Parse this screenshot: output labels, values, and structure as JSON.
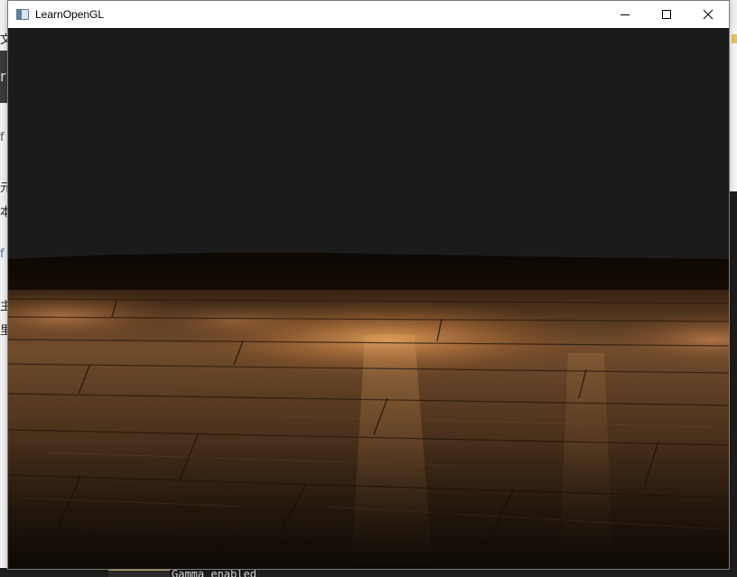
{
  "window": {
    "title": "LearnOpenGL",
    "controls": {
      "minimize": "minimize-icon",
      "maximize": "maximize-icon",
      "close": "close-icon"
    }
  },
  "scene": {
    "description_colors": {
      "sky": "#1b1b1b",
      "floor_dark": "#1a120b",
      "wood_mid": "#6b4526",
      "light_glow": "#e2a25a"
    }
  },
  "console": {
    "line": "Gamma enabled"
  },
  "background_glyphs": [
    "文",
    "r",
    "f",
    "元",
    "本",
    "f",
    "主",
    "里"
  ]
}
